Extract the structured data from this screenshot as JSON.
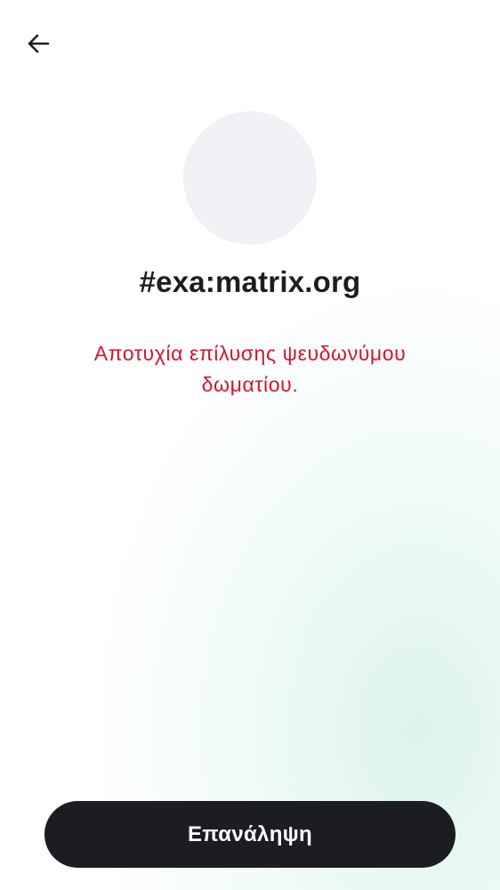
{
  "header": {
    "back_icon": "arrow-left-icon"
  },
  "room": {
    "alias": "#exa:matrix.org",
    "avatar_color": "#f0f1f5"
  },
  "error": {
    "message": "Αποτυχία επίλυσης ψευδωνύμου δωματίου.",
    "color": "#d1162d"
  },
  "actions": {
    "retry_label": "Επανάληψη",
    "button_color": "#1b1d22"
  }
}
